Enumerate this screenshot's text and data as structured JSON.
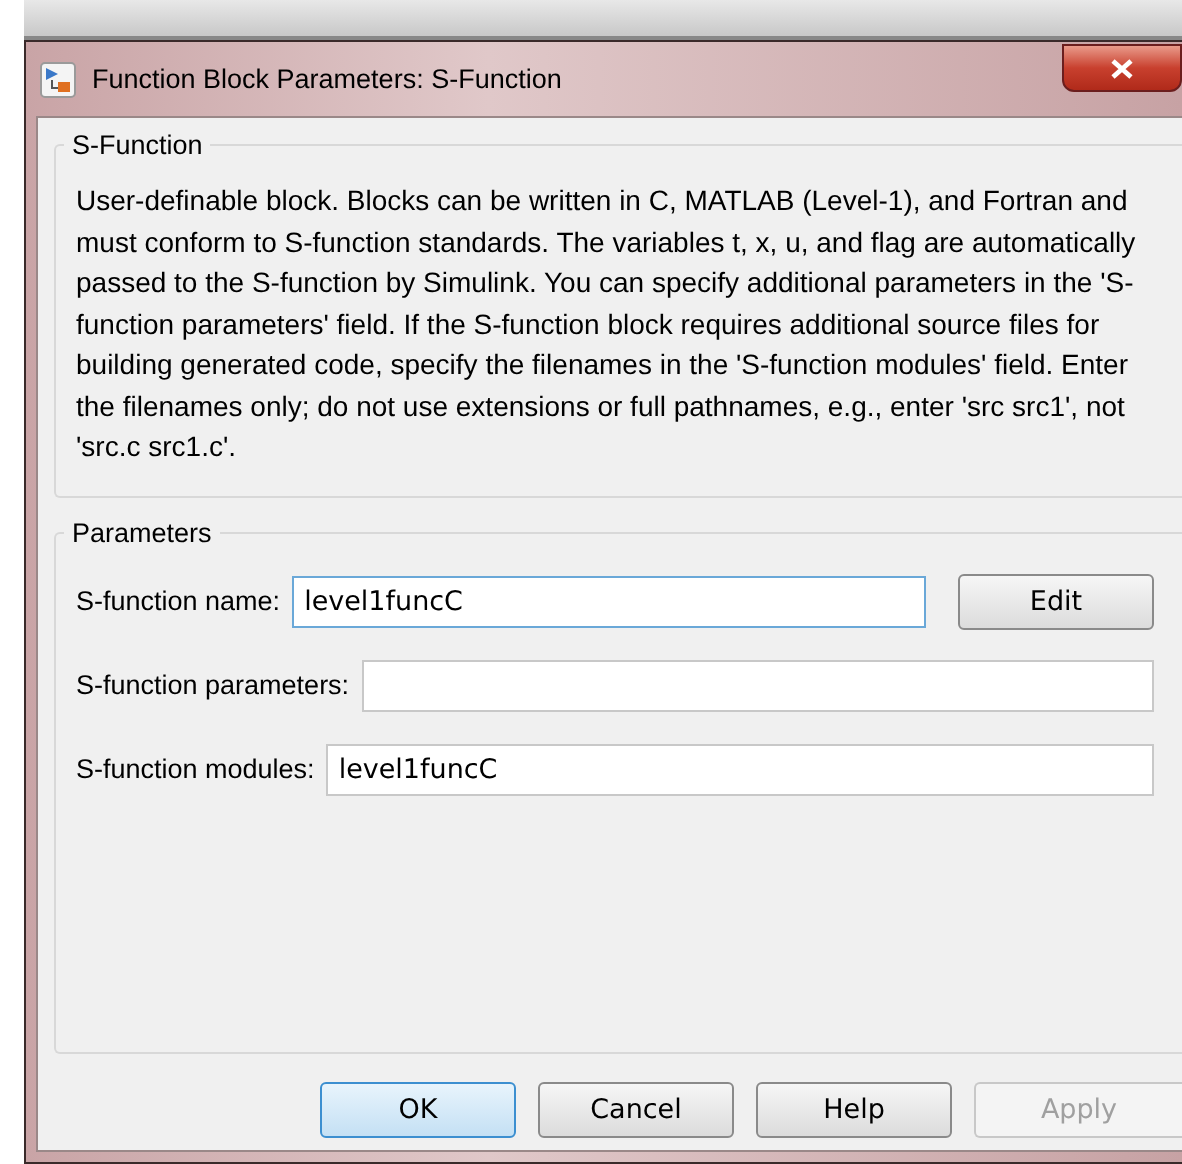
{
  "window": {
    "title": "Function Block Parameters: S-Function"
  },
  "description_group": {
    "title": "S-Function",
    "text": "User-definable block.  Blocks can be written in C, MATLAB (Level-1), and Fortran and must conform to S-function standards.  The variables t, x, u, and flag are automatically passed to the S-function by Simulink.  You can specify additional parameters in the 'S-function parameters' field. If the S-function block requires additional source files for building generated code, specify the filenames in the 'S-function modules' field. Enter the filenames only; do not use extensions or full pathnames, e.g., enter 'src src1', not 'src.c src1.c'."
  },
  "parameters_group": {
    "title": "Parameters",
    "fields": [
      {
        "label": "S-function name:",
        "value": "level1funcC",
        "focused": true,
        "button": "Edit"
      },
      {
        "label": "S-function parameters:",
        "focused": false
      },
      {
        "label": "S-function modules:",
        "value": "level1funcC",
        "focused": false
      }
    ]
  },
  "buttons": [
    {
      "label": "OK",
      "default": true,
      "disabled": false
    },
    {
      "label": "Cancel",
      "default": false,
      "disabled": false
    },
    {
      "label": "Help",
      "default": false,
      "disabled": false
    },
    {
      "label": "Apply",
      "default": false,
      "disabled": true
    }
  ]
}
